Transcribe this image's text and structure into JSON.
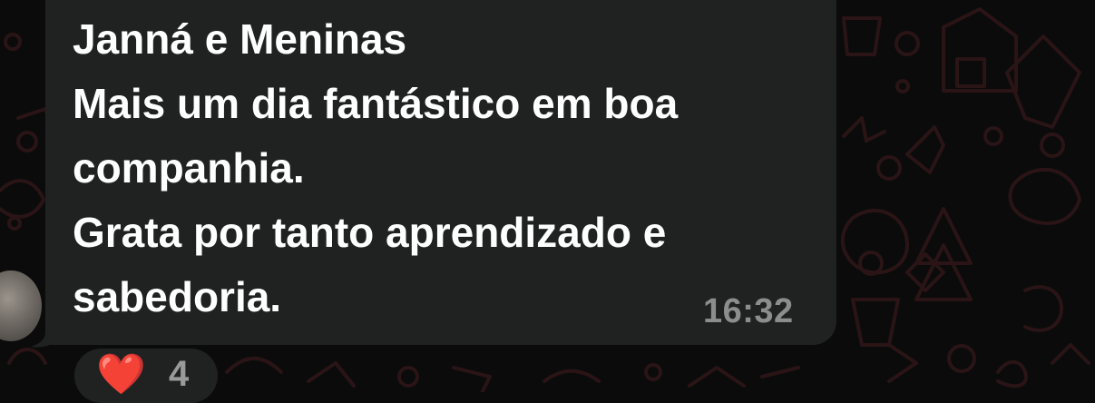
{
  "message": {
    "lines": [
      "Janná e Meninas",
      "Mais um dia fantástico em boa",
      "companhia.",
      "Grata por tanto aprendizado e",
      "sabedoria."
    ],
    "time": "16:32"
  },
  "reaction": {
    "emoji": "❤️",
    "count": "4"
  },
  "colors": {
    "background": "#0b0b0b",
    "bubble": "#202222",
    "wallpaper_doodle": "#2a1416",
    "text": "#ffffff",
    "meta_text": "#8d8d8d",
    "heart": "#e0202c"
  }
}
